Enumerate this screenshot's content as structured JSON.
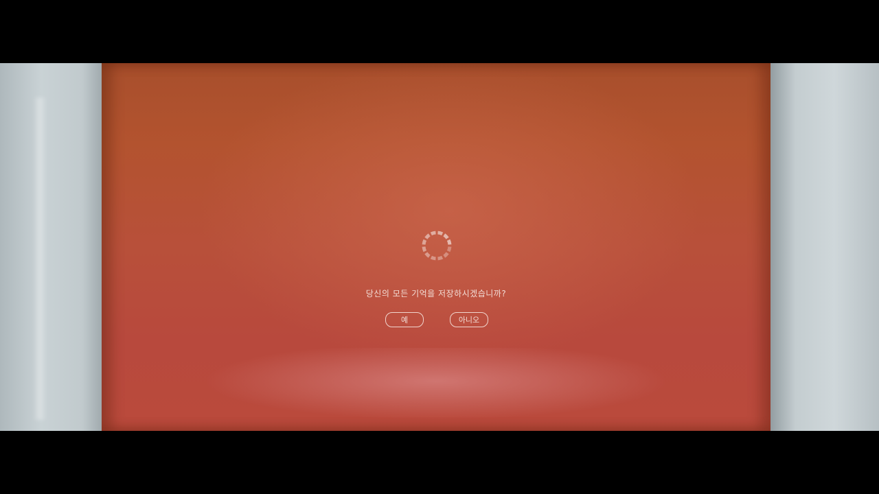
{
  "dialog": {
    "message": "당신의 모든 기억을 저장하시겠습니까?",
    "yes_label": "예",
    "no_label": "아니오"
  },
  "icons": {
    "spinner": "loading-spinner-icon"
  },
  "colors": {
    "screen": "#b8503a",
    "text": "#f3ddd6",
    "letterbox": "#000000"
  }
}
